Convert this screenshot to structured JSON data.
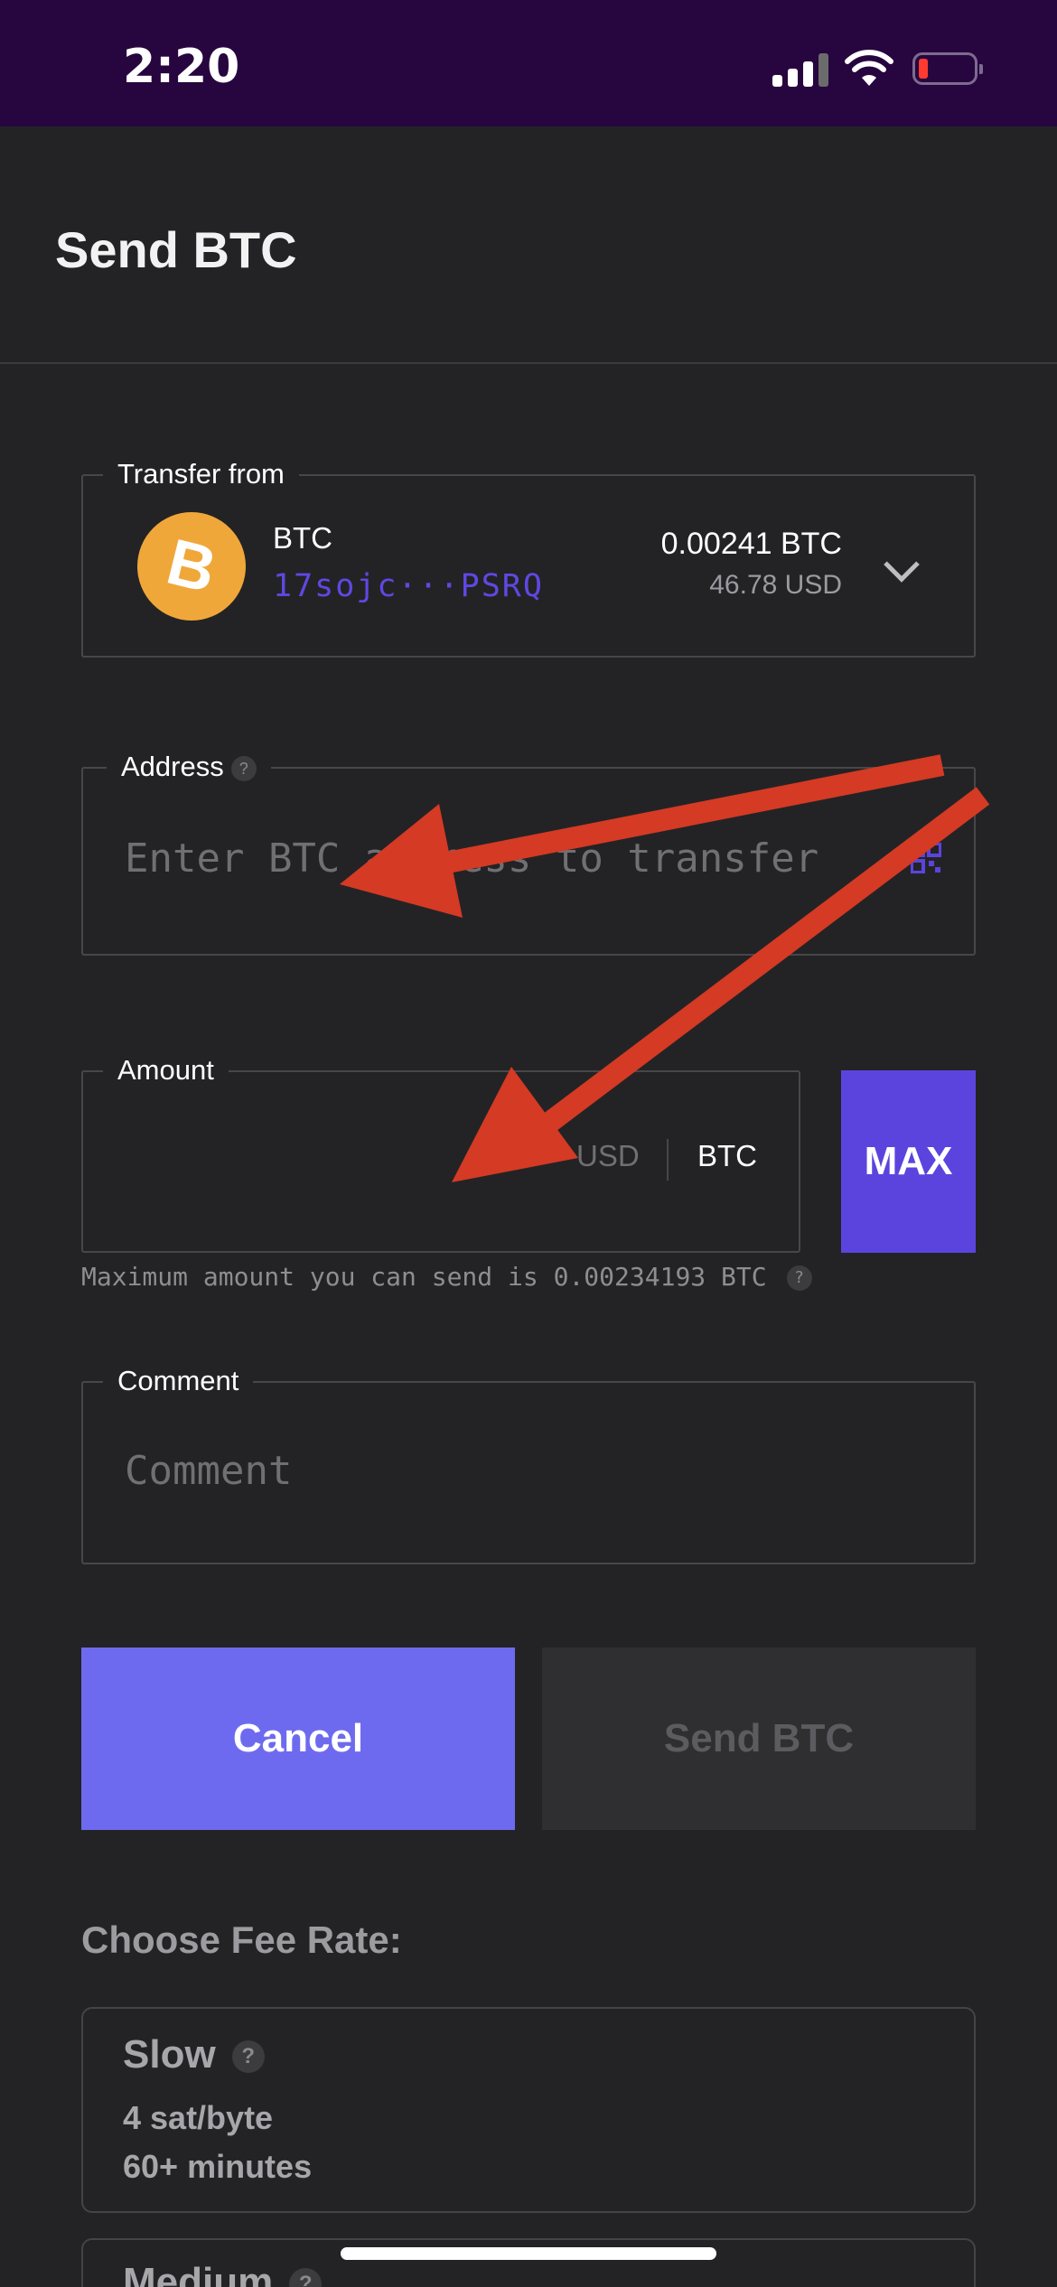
{
  "status_bar": {
    "time": "2:20"
  },
  "header": {
    "title": "Send BTC"
  },
  "transfer_from": {
    "legend": "Transfer from",
    "coin_symbol": "B",
    "coin_name": "BTC",
    "address": "17sojc···PSRQ",
    "balance_btc": "0.00241 BTC",
    "balance_usd": "46.78 USD"
  },
  "address_field": {
    "legend": "Address",
    "help": "?",
    "placeholder": "Enter BTC address to transfer"
  },
  "amount_field": {
    "legend": "Amount",
    "unit_usd": "USD",
    "unit_btc": "BTC",
    "max_label": "MAX",
    "hint": "Maximum amount you can send is 0.00234193 BTC",
    "hint_help": "?"
  },
  "comment_field": {
    "legend": "Comment",
    "placeholder": "Comment"
  },
  "actions": {
    "cancel_label": "Cancel",
    "send_label": "Send BTC"
  },
  "fee": {
    "title": "Choose Fee Rate:",
    "options": [
      {
        "name": "Slow",
        "help": "?",
        "rate": "4 sat/byte",
        "time": "60+ minutes"
      },
      {
        "name": "Medium",
        "help": "?"
      }
    ]
  },
  "colors": {
    "accent": "#5b44de",
    "cancel": "#6e6aef",
    "btc_orange": "#f0a73a",
    "annotation_arrow": "#d43a24"
  }
}
